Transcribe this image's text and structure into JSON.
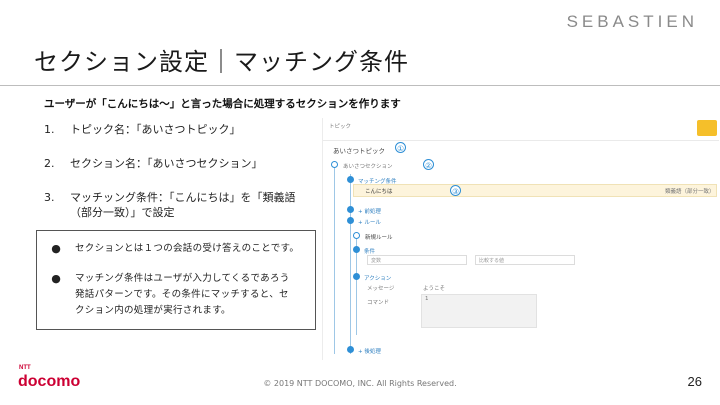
{
  "header": {
    "brand": "SEBASTIEN",
    "title": "セクション設定｜マッチング条件"
  },
  "subtitle": "ユーザーが「こんにちは〜」と言った場合に処理するセクションを作ります",
  "steps": [
    {
      "num": "1.",
      "text": "トピック名：「あいさつトピック」"
    },
    {
      "num": "2.",
      "text": "セクション名：「あいさつセクション」"
    },
    {
      "num": "3.",
      "text": "マッチッング条件：「こんにちは」を「類義語（部分一致）」で設定"
    }
  ],
  "notes": [
    {
      "bullet": "●",
      "text": "セクションとは１つの会話の受け答えのことです。"
    },
    {
      "bullet": "●",
      "text": "マッチング条件はユーザが入力してくるであろう発話パターンです。その条件にマッチすると、セクション内の処理が実行されます。"
    }
  ],
  "screenshot": {
    "topic_label": "トピック",
    "topic_name": "あいさつトピック",
    "section_name": "あいさつセクション",
    "match_label": "マッチング条件",
    "match_value": "こんにちは",
    "match_type": "類義語（部分一致）",
    "add_condition": "+ 前処理",
    "add_rule": "+ ルール",
    "new_rule": "新規ルール",
    "condition": "条件",
    "var_placeholder": "変数",
    "cond_placeholder": "比較する値",
    "action": "アクション",
    "message": "メッセージ",
    "message_value": "ようこそ",
    "command": "コマンド",
    "line_no": "1",
    "post_process": "+ 後処理",
    "badges": [
      "①",
      "②",
      "③"
    ]
  },
  "footer": {
    "logo": "docomo",
    "logo_sup": "NTT",
    "copyright": "© 2019 NTT DOCOMO, INC. All Rights Reserved.",
    "page": "26"
  },
  "colors": {
    "accent": "#2e8fd6",
    "yellow": "#f5bf2a",
    "brand_red": "#cc0033"
  }
}
